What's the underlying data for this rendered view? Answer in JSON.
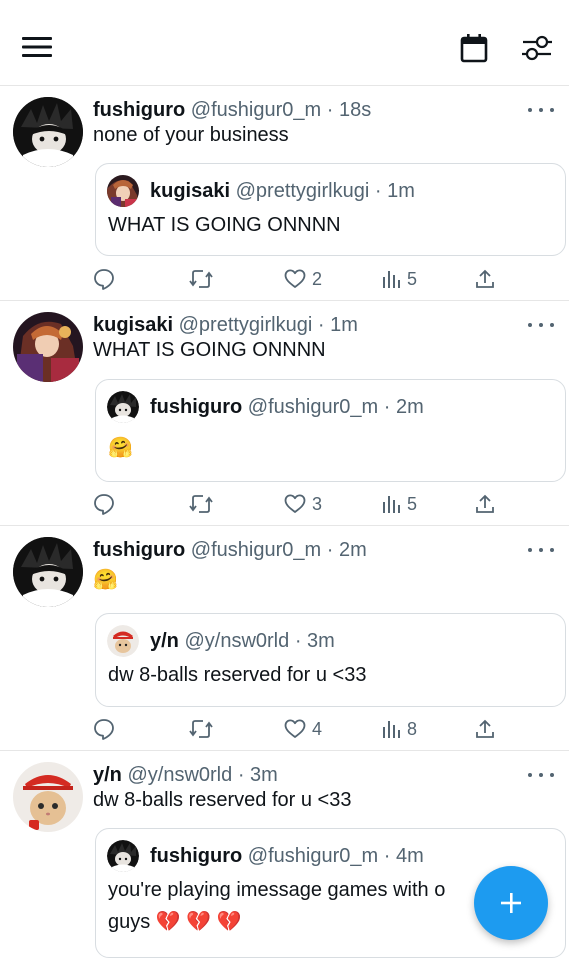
{
  "topbar": {
    "menu_icon": "hamburger-menu-icon",
    "calendar_icon": "calendar-icon",
    "settings_icon": "sliders-icon"
  },
  "tweets": [
    {
      "name": "fushiguro",
      "handle": "@fushigur0_m",
      "time": "18s",
      "text": "none of your business",
      "quote": {
        "name": "kugisaki",
        "handle": "@prettygirlkugi",
        "time": "1m",
        "text": "WHAT IS GOING ONNNN"
      },
      "replies": "",
      "likes": "2",
      "views": "5"
    },
    {
      "name": "kugisaki",
      "handle": "@prettygirlkugi",
      "time": "1m",
      "text": "WHAT IS GOING ONNNN",
      "quote": {
        "name": "fushiguro",
        "handle": "@fushigur0_m",
        "time": "2m",
        "text": "🤗"
      },
      "likes": "3",
      "views": "5"
    },
    {
      "name": "fushiguro",
      "handle": "@fushigur0_m",
      "time": "2m",
      "text": "🤗",
      "quote": {
        "name": "y/n",
        "handle": "@y/nsw0rld",
        "time": "3m",
        "text": "dw 8-balls reserved for u <33"
      },
      "likes": "4",
      "views": "8"
    },
    {
      "name": "y/n",
      "handle": "@y/nsw0rld",
      "time": "3m",
      "text": "dw 8-balls reserved for u <33",
      "quote": {
        "name": "fushiguro",
        "handle": "@fushigur0_m",
        "time": "4m",
        "text_line1": "you're playing imessage games with o",
        "text_line2": "guys 💔 💔 💔"
      }
    }
  ],
  "meta_sep": "·",
  "fab_icon": "plus-icon"
}
